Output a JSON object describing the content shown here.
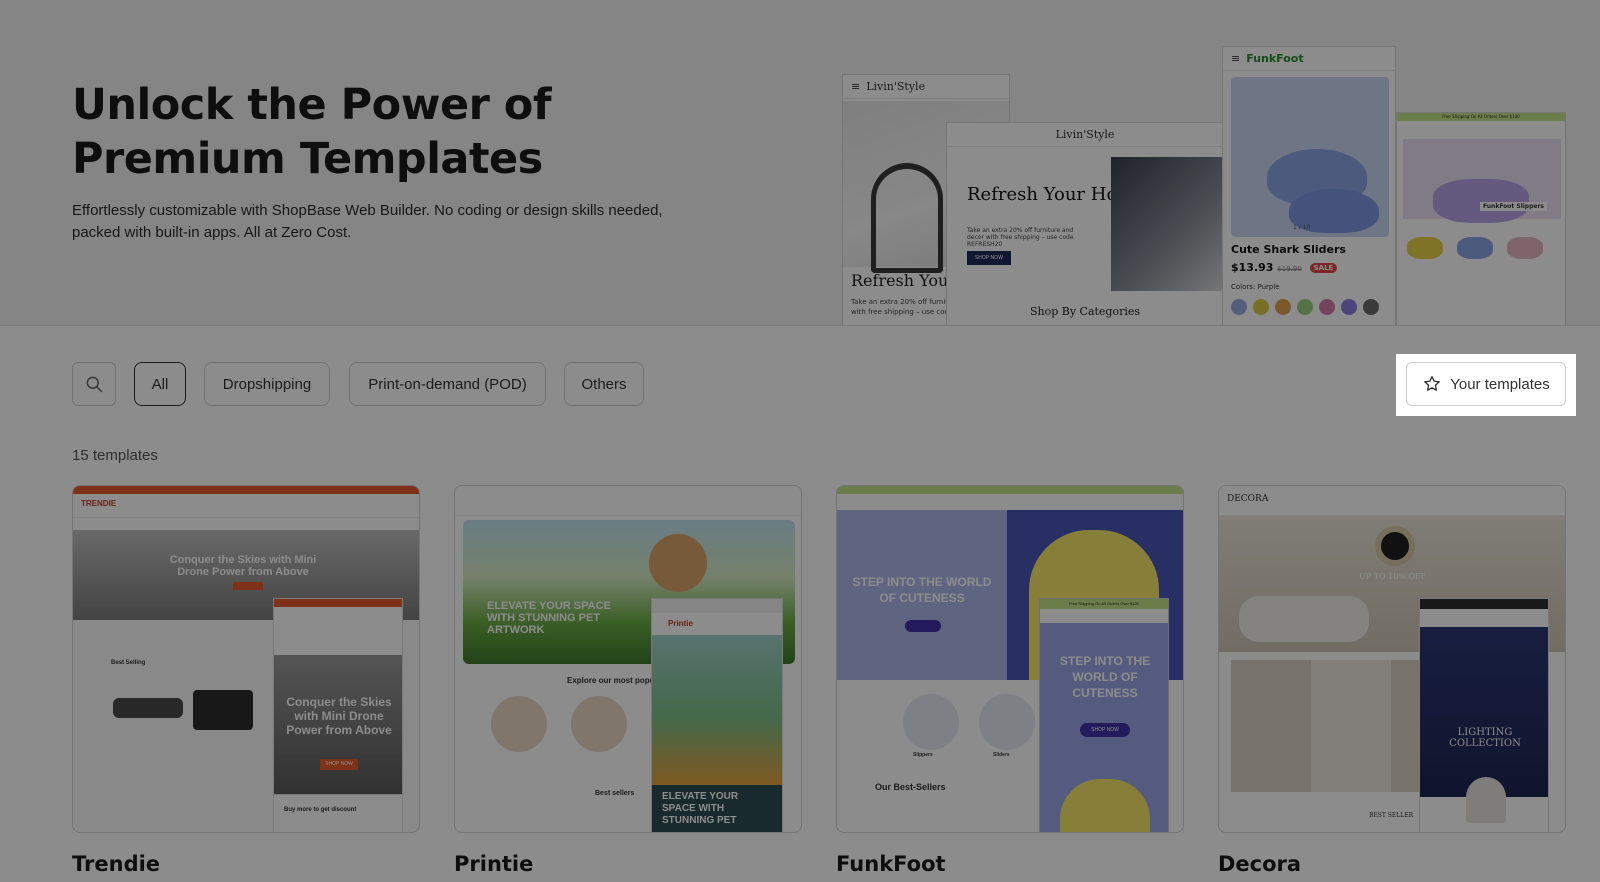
{
  "hero": {
    "title": "Unlock the Power of Premium Templates",
    "description": "Effortlessly customizable with ShopBase Web Builder. No coding or design skills needed, packed with built-in apps. All at Zero Cost.",
    "previews": {
      "livinstyle_logo": "Livin'Style",
      "livinstyle_heading": "Refresh Your",
      "livinstyle_sub": "Take an extra 20% off furniture and decor with free shipping – use code REFRESH20",
      "livinstyle_desktop_heading": "Refresh Your Home",
      "livinstyle_desktop_sub": "Take an extra 20% off furniture and decor with free shipping – use code REFRESH20",
      "livinstyle_desktop_button": "SHOP NOW",
      "livinstyle_categories": "Shop By Categories",
      "funkfoot_logo": "FunkFoot",
      "funkfoot_product": "Cute Shark Sliders",
      "funkfoot_price": "$13.93",
      "funkfoot_compare_price": "$19.90",
      "funkfoot_sale": "SALE",
      "funkfoot_colors_label": "Colors: Purple",
      "funkfoot_banner_top": "Free Shipping On All Orders Over $100",
      "funkfoot_slippers_label": "FunkFoot Slippers",
      "swatches": [
        "#9aa9e0",
        "#d9c84a",
        "#e0a050",
        "#9bcf82",
        "#d47aa8",
        "#8a7ee0",
        "#6a6a6a"
      ],
      "funkfoot_slide_counter": "1 / 10"
    }
  },
  "filters": {
    "search_icon": "search-icon",
    "chips": [
      "All",
      "Dropshipping",
      "Print-on-demand (POD)",
      "Others"
    ],
    "active": "All",
    "your_templates": "Your templates",
    "your_templates_icon": "star-icon"
  },
  "count_label": "15 templates",
  "templates": [
    {
      "name": "Trendie",
      "preview": {
        "headline": "Conquer the Skies with Mini Drone Power from Above",
        "mobile_headline": "Conquer the Skies with Mini Drone Power from Above",
        "button": "SHOP NOW",
        "section": "Best Selling",
        "promo": "Buy more to get discount"
      }
    },
    {
      "name": "Printie",
      "preview": {
        "headline": "ELEVATE YOUR SPACE WITH STUNNING PET ARTWORK",
        "section": "Explore our most popular c",
        "mobile_footer": "ELEVATE YOUR SPACE WITH STUNNING PET",
        "best_sellers": "Best sellers",
        "mobile_logo": "Printie"
      }
    },
    {
      "name": "FunkFoot",
      "preview": {
        "headline": "STEP INTO THE WORLD OF CUTENESS",
        "mobile_headline": "STEP INTO THE WORLD OF CUTENESS",
        "button": "SHOP NOW",
        "section": "Our Best-Sellers",
        "mobile_banner": "Free Shipping On All Orders Over $100",
        "cat1": "Slippers",
        "cat2": "Sliders"
      }
    },
    {
      "name": "Decora",
      "preview": {
        "logo": "DECORA",
        "headline": "UP TO 10% OFF",
        "mobile_headline": "LIGHTING COLLECTION",
        "section": "BEST SELLER"
      }
    }
  ],
  "colors": {
    "overlay": "rgba(0,0,0,0.45)",
    "trendie_accent": "#e85a2a",
    "funkfoot_accent": "#4032a8",
    "funkfoot_banner": "#c5e38a"
  }
}
